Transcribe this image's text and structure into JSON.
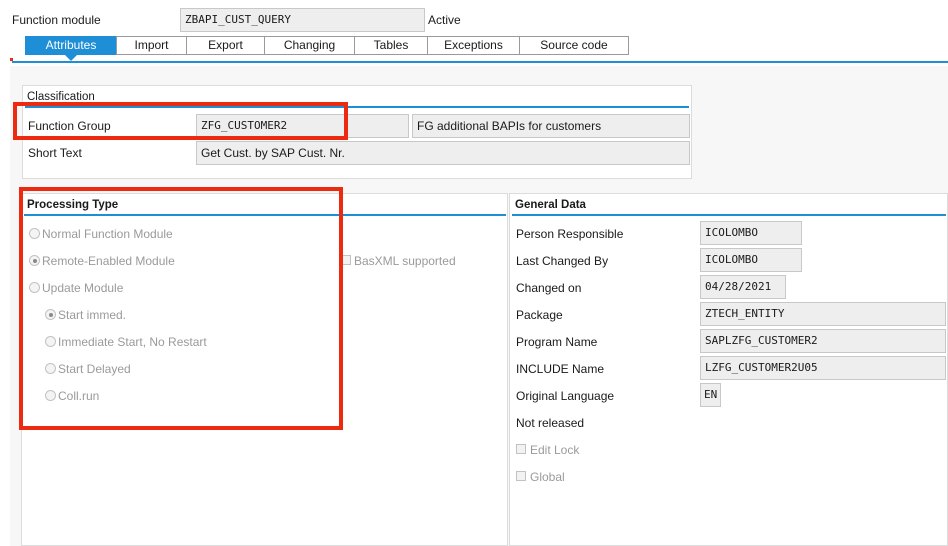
{
  "header": {
    "function_module_label": "Function module",
    "function_module_value": "ZBAPI_CUST_QUERY",
    "status": "Active"
  },
  "tabs": [
    "Attributes",
    "Import",
    "Export",
    "Changing",
    "Tables",
    "Exceptions",
    "Source code"
  ],
  "active_tab": "Attributes",
  "classification": {
    "title": "Classification",
    "function_group_label": "Function Group",
    "function_group_value": "ZFG_CUSTOMER2",
    "function_group_desc": "FG additional BAPIs for customers",
    "short_text_label": "Short Text",
    "short_text_value": "Get Cust. by SAP Cust. Nr."
  },
  "processing_type": {
    "title": "Processing Type",
    "options": [
      "Normal Function Module",
      "Remote-Enabled Module",
      "Update Module"
    ],
    "selected": "Remote-Enabled Module",
    "basxml_label": "BasXML supported",
    "update_options": [
      "Start immed.",
      "Immediate Start, No Restart",
      "Start Delayed",
      "Coll.run"
    ],
    "update_selected": "Start immed."
  },
  "general_data": {
    "title": "General Data",
    "person_responsible_label": "Person Responsible",
    "person_responsible_value": "ICOLOMBO",
    "last_changed_by_label": "Last Changed By",
    "last_changed_by_value": "ICOLOMBO",
    "changed_on_label": "Changed on",
    "changed_on_value": "04/28/2021",
    "package_label": "Package",
    "package_value": "ZTECH_ENTITY",
    "program_name_label": "Program Name",
    "program_name_value": "SAPLZFG_CUSTOMER2",
    "include_name_label": "INCLUDE Name",
    "include_name_value": "LZFG_CUSTOMER2U05",
    "original_language_label": "Original Language",
    "original_language_value": "EN",
    "release_status": "Not released",
    "edit_lock_label": "Edit Lock",
    "global_label": "Global"
  },
  "colors": {
    "accent": "#1e8fd6",
    "highlight": "#ec2a10",
    "field_bg": "#eeeeee"
  }
}
